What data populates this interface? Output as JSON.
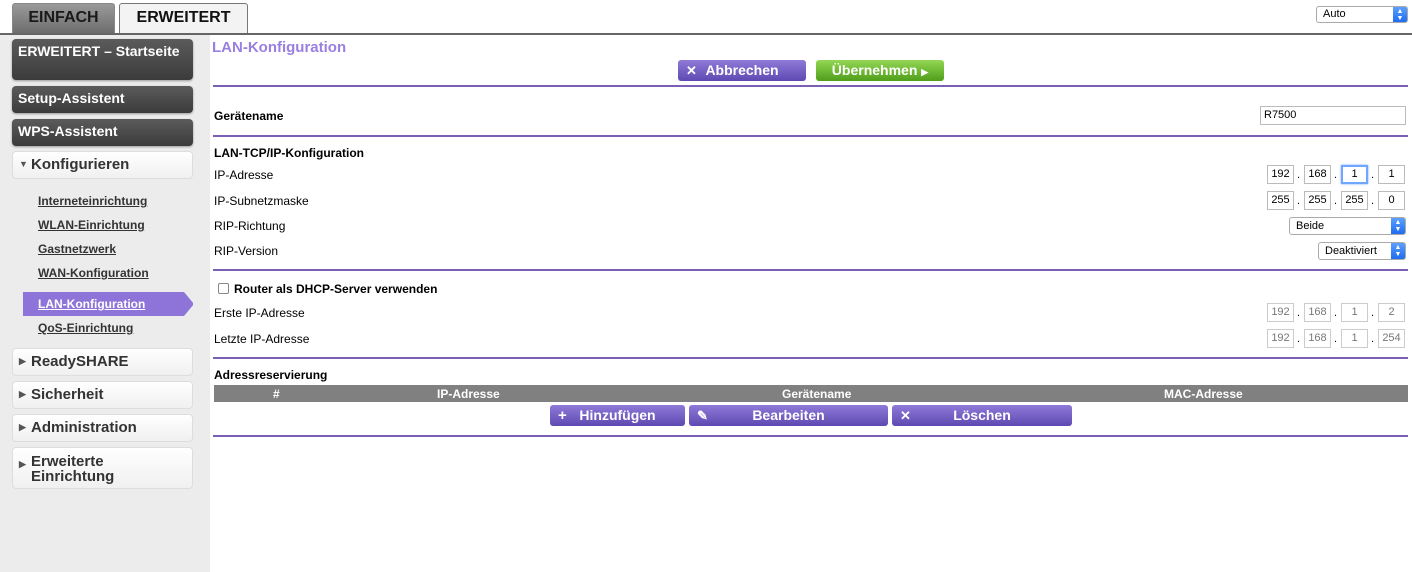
{
  "tabs": {
    "basic": "EINFACH",
    "advanced": "ERWEITERT"
  },
  "language_select": {
    "value": "Auto"
  },
  "sidebar": {
    "home": "ERWEITERT – Startseite",
    "setup_wizard": "Setup-Assistent",
    "wps_wizard": "WPS-Assistent",
    "configure": "Konfigurieren",
    "sub_items": [
      "Interneteinrichtung",
      "WLAN-Einrichtung",
      "Gastnetzwerk",
      "WAN-Konfiguration",
      "LAN-Konfiguration",
      "QoS-Einrichtung"
    ],
    "readyshare": "ReadySHARE",
    "security": "Sicherheit",
    "administration": "Administration",
    "advanced_setup": "Erweiterte Einrichtung"
  },
  "main": {
    "title": "LAN-Konfiguration",
    "cancel": "Abbrechen",
    "apply": "Übernehmen",
    "device_name_label": "Gerätename",
    "device_name_value": "R7500",
    "lan_tcpip_header": "LAN-TCP/IP-Konfiguration",
    "ip_label": "IP-Adresse",
    "ip": [
      "192",
      "168",
      "1",
      "1"
    ],
    "subnet_label": "IP-Subnetzmaske",
    "subnet": [
      "255",
      "255",
      "255",
      "0"
    ],
    "rip_dir_label": "RIP-Richtung",
    "rip_dir_value": "Beide",
    "rip_ver_label": "RIP-Version",
    "rip_ver_value": "Deaktiviert",
    "dhcp_label": "Router als DHCP-Server verwenden",
    "first_ip_label": "Erste IP-Adresse",
    "first_ip": [
      "192",
      "168",
      "1",
      "2"
    ],
    "last_ip_label": "Letzte IP-Adresse",
    "last_ip": [
      "192",
      "168",
      "1",
      "254"
    ],
    "reservation_header": "Adressreservierung",
    "table_cols": [
      "#",
      "IP-Adresse",
      "Gerätename",
      "MAC-Adresse"
    ],
    "add": "Hinzufügen",
    "edit": "Bearbeiten",
    "delete": "Löschen"
  }
}
